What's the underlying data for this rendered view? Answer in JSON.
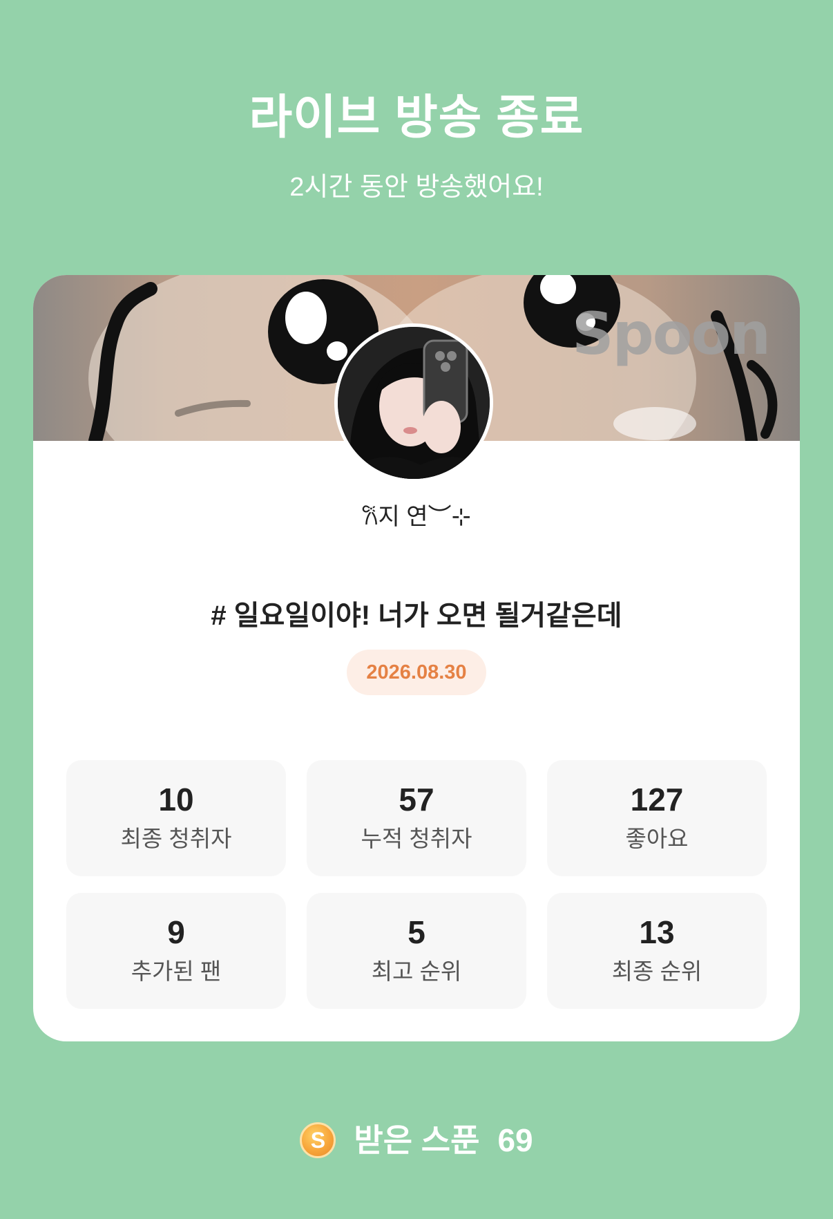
{
  "header": {
    "title": "라이브 방송 종료",
    "subtitle": "2시간 동안 방송했어요!"
  },
  "banner": {
    "brand": "Spoon"
  },
  "profile": {
    "nickname": "𐙚지 연︶⊹"
  },
  "broadcast": {
    "title": "# 일요일이야! 너가 오면 될거같은데",
    "date": "2026.08.30"
  },
  "stats": [
    {
      "value": "10",
      "label": "최종 청취자"
    },
    {
      "value": "57",
      "label": "누적 청취자"
    },
    {
      "value": "127",
      "label": "좋아요"
    },
    {
      "value": "9",
      "label": "추가된 팬"
    },
    {
      "value": "5",
      "label": "최고 순위"
    },
    {
      "value": "13",
      "label": "최종 순위"
    }
  ],
  "footer": {
    "coin_letter": "S",
    "label": "받은 스푼",
    "value": "69"
  },
  "colors": {
    "background": "#94d2aa",
    "card": "#ffffff",
    "date_text": "#e58144",
    "date_bg": "#fdeee6",
    "stat_bg": "#f7f7f7"
  }
}
